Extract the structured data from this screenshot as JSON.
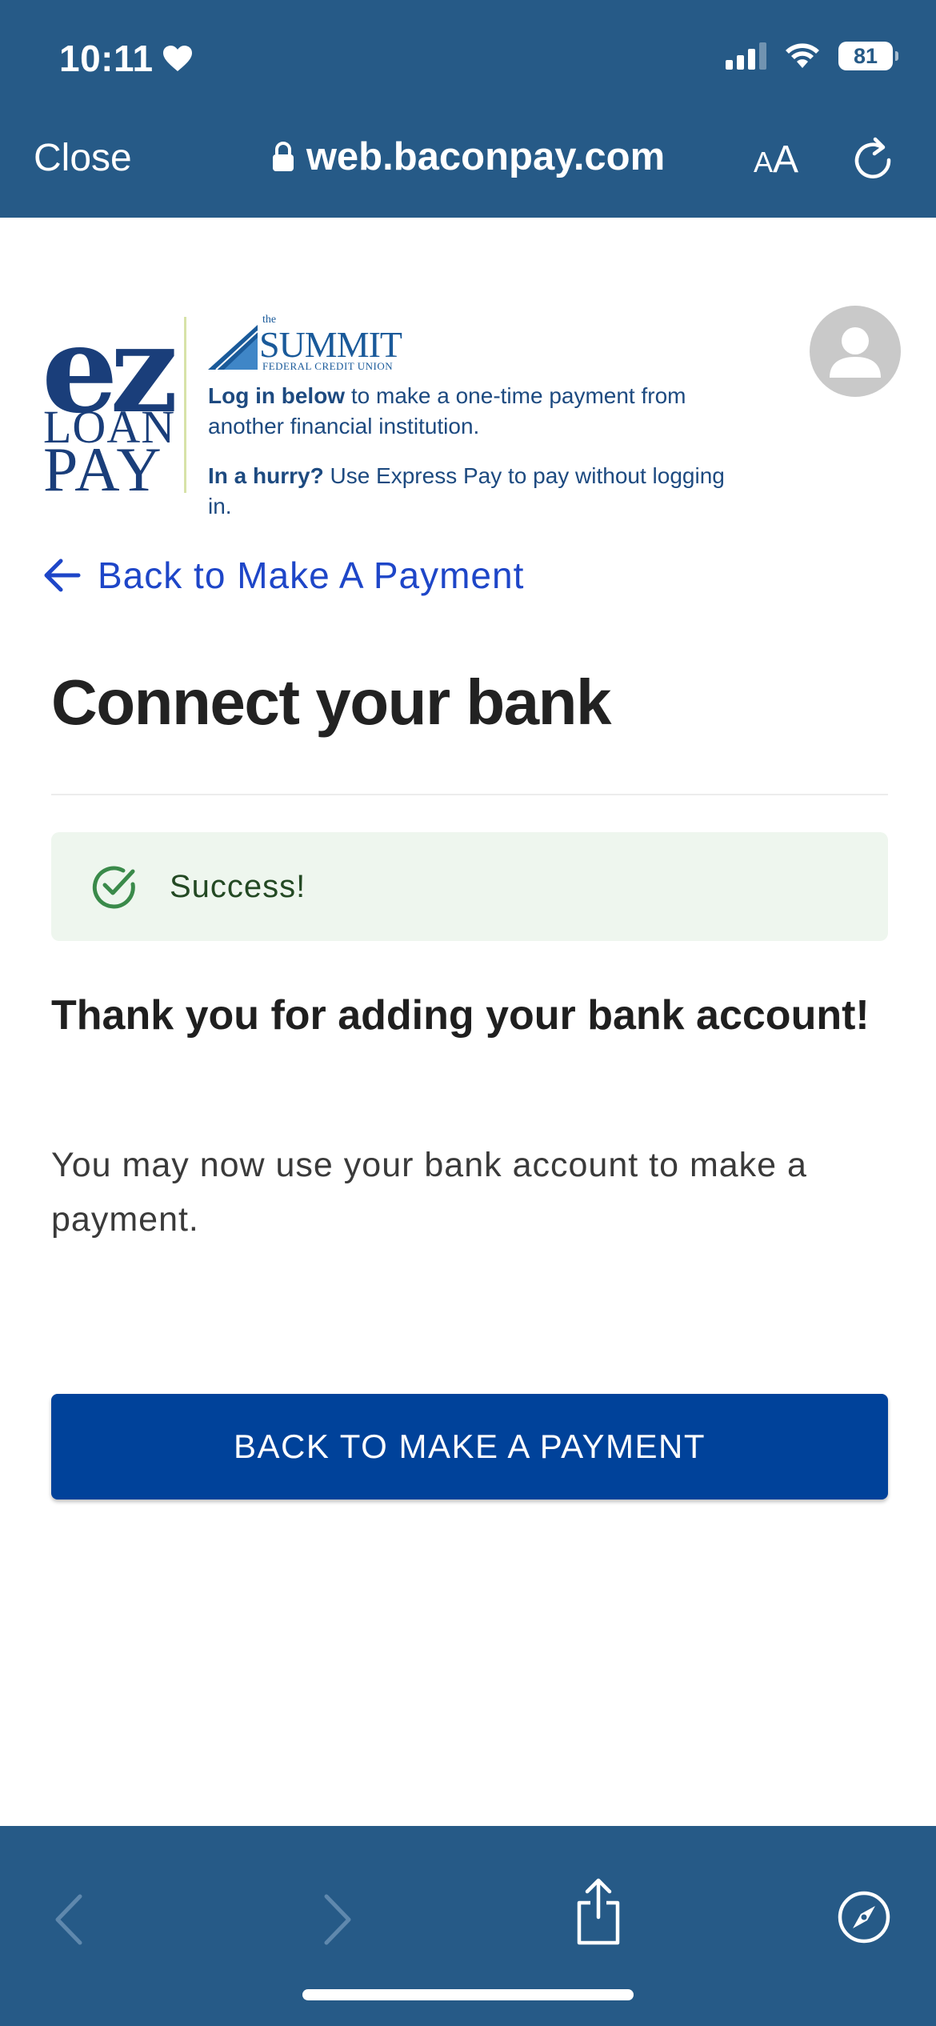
{
  "status_bar": {
    "time": "10:11",
    "battery": "81"
  },
  "browser": {
    "close_label": "Close",
    "url": "web.baconpay.com",
    "text_size_label_small": "A",
    "text_size_label_large": "A"
  },
  "banner": {
    "ez_mark": "ez",
    "ez_loan": "LOAN",
    "ez_pay": "PAY",
    "summit_the": "the",
    "summit_name": "SUMMIT",
    "summit_sub": "FEDERAL CREDIT UNION",
    "login_bold": "Log in below",
    "login_rest": " to make a one-time payment from another financial institution.",
    "hurry_bold": "In a hurry?",
    "hurry_rest": " Use Express Pay to pay without logging in."
  },
  "nav": {
    "back_link_label": "Back to Make A Payment"
  },
  "main": {
    "title": "Connect your bank",
    "success_message": "Success!",
    "thanks_heading": "Thank you for adding your bank account!",
    "body_text": "You may now use your bank account to make a payment.",
    "primary_button_label": "BACK TO MAKE A PAYMENT"
  },
  "colors": {
    "chrome": "#265a87",
    "link": "#1e46c8",
    "primary_button": "#00429a",
    "success_bg": "#eef6ee",
    "success_icon": "#3a8a4a"
  },
  "icons": {
    "status_heart": "heart-icon",
    "lock": "lock-icon",
    "reload": "reload-icon",
    "back_arrow": "arrow-left-icon",
    "success": "check-circle-icon",
    "avatar": "user-icon",
    "toolbar": [
      "chevron-left-icon",
      "chevron-right-icon",
      "share-icon",
      "compass-icon"
    ]
  }
}
